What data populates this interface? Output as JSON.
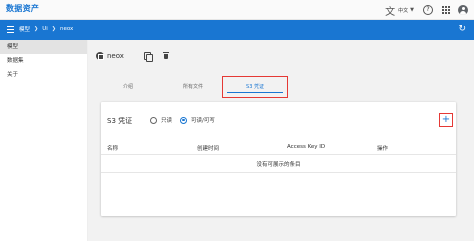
{
  "app": {
    "title": "数据资产"
  },
  "topbar": {
    "language": "中文",
    "help_glyph": "?"
  },
  "breadcrumb": [
    "模型",
    "Ui",
    "neox"
  ],
  "sidebar": {
    "items": [
      {
        "label": "模型",
        "active": true
      },
      {
        "label": "数据集",
        "active": false
      },
      {
        "label": "关于",
        "active": false
      }
    ]
  },
  "object": {
    "name": "neox"
  },
  "tabs": [
    {
      "label": "介绍",
      "active": false
    },
    {
      "label": "所有文件",
      "active": false
    },
    {
      "label": "S3 凭证",
      "active": true
    }
  ],
  "s3": {
    "title": "S3 凭证",
    "radios": [
      {
        "label": "只读",
        "selected": false
      },
      {
        "label": "可读/可写",
        "selected": true
      }
    ],
    "add_glyph": "+",
    "columns": [
      "名称",
      "创建时间",
      "Access Key ID",
      "操作"
    ],
    "empty_message": "没有可展示的条目"
  },
  "colors": {
    "primary": "#1976d2",
    "highlight": "#e53935",
    "background": "#f2f2f2"
  }
}
